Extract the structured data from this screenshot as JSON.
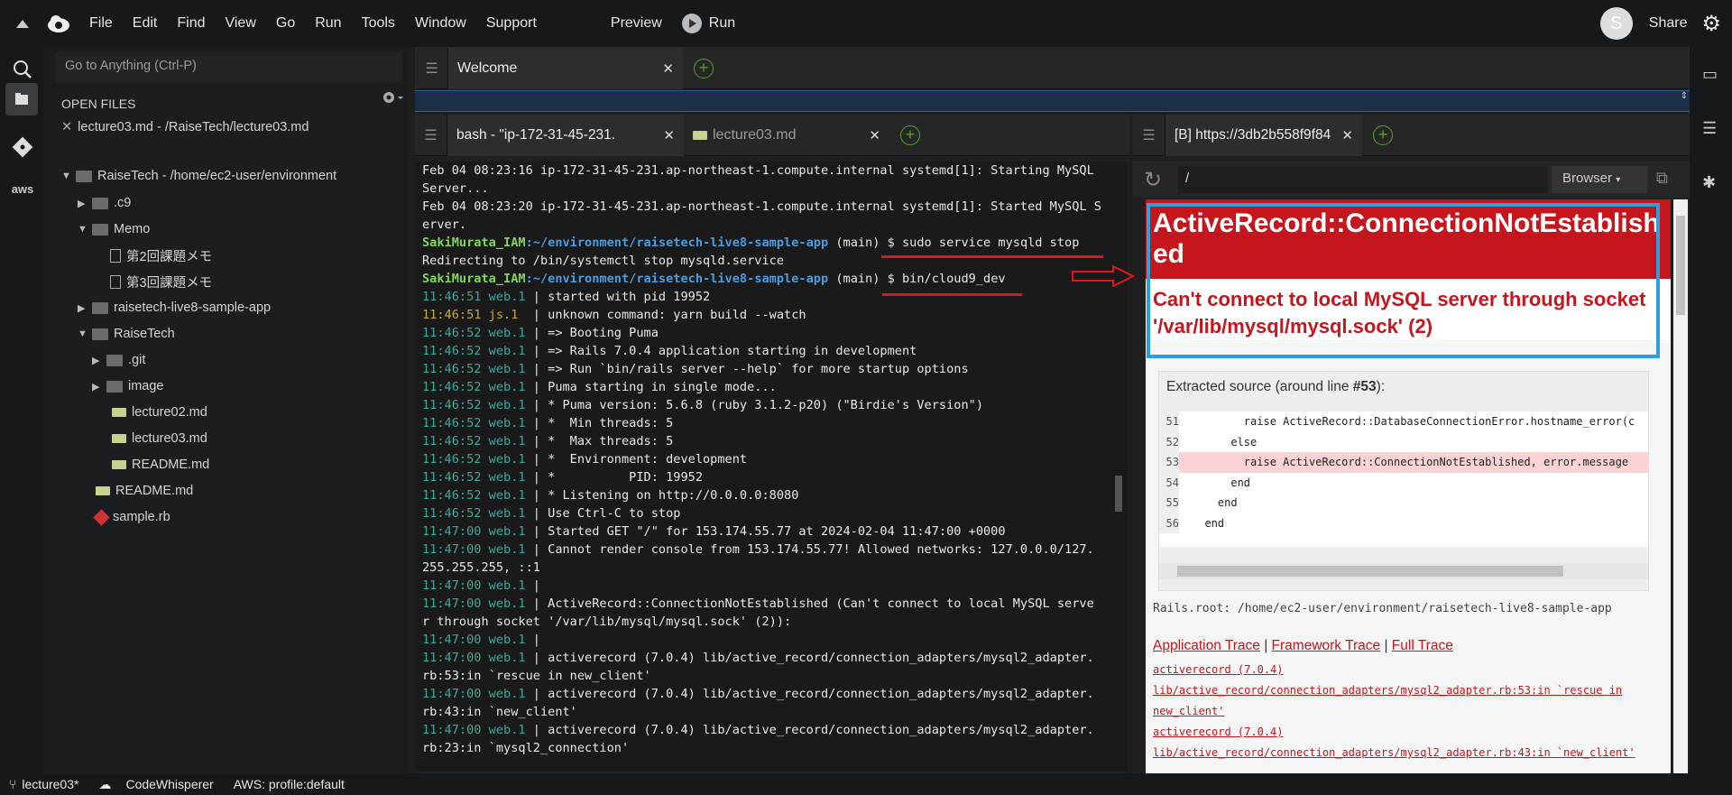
{
  "menubar": {
    "items": [
      "File",
      "Edit",
      "Find",
      "View",
      "Go",
      "Run",
      "Tools",
      "Window",
      "Support"
    ],
    "preview": "Preview",
    "run": "Run",
    "avatar_letter": "S",
    "share": "Share"
  },
  "sidebar": {
    "goto_placeholder": "Go to Anything (Ctrl-P)",
    "open_files_header": "OPEN FILES",
    "open_file": "lecture03.md - /RaiseTech/lecture03.md",
    "tree": [
      {
        "label": "RaiseTech - /home/ec2-user/environment",
        "kind": "folder",
        "open": true
      },
      {
        "label": ".c9",
        "kind": "folder",
        "open": false
      },
      {
        "label": "Memo",
        "kind": "folder",
        "open": true
      },
      {
        "label": "第2回課題メモ",
        "kind": "doc"
      },
      {
        "label": "第3回課題メモ",
        "kind": "doc"
      },
      {
        "label": "raisetech-live8-sample-app",
        "kind": "folder",
        "open": false
      },
      {
        "label": "RaiseTech",
        "kind": "folder",
        "open": true
      },
      {
        "label": ".git",
        "kind": "folder",
        "open": false
      },
      {
        "label": "image",
        "kind": "folder",
        "open": false
      },
      {
        "label": "lecture02.md",
        "kind": "md"
      },
      {
        "label": "lecture03.md",
        "kind": "md"
      },
      {
        "label": "README.md",
        "kind": "md"
      },
      {
        "label": "README.md",
        "kind": "md"
      },
      {
        "label": "sample.rb",
        "kind": "rb"
      }
    ]
  },
  "tabs": {
    "welcome": "Welcome",
    "bash": "bash - \"ip-172-31-45-231.",
    "lecture": "lecture03.md",
    "browser": "[B] https://3db2b558f9f84"
  },
  "terminal": {
    "lines": [
      [
        "",
        "Feb 04 08:23:16 ip-172-31-45-231.ap-northeast-1.compute.internal systemd[1]: Starting MySQL"
      ],
      [
        "",
        "Server..."
      ],
      [
        "",
        "Feb 04 08:23:20 ip-172-31-45-231.ap-northeast-1.compute.internal systemd[1]: Started MySQL S"
      ],
      [
        "",
        "erver."
      ],
      [
        "prompt",
        "$ sudo service mysqld stop"
      ],
      [
        "",
        "Redirecting to /bin/systemctl stop mysqld.service"
      ],
      [
        "prompt",
        "$ bin/cloud9_dev"
      ],
      [
        "11:46:51 web.1",
        "| started with pid 19952"
      ],
      [
        "11:46:51 js.1 ",
        "| unknown command: yarn build --watch"
      ],
      [
        "11:46:52 web.1",
        "| => Booting Puma"
      ],
      [
        "11:46:52 web.1",
        "| => Rails 7.0.4 application starting in development"
      ],
      [
        "11:46:52 web.1",
        "| => Run `bin/rails server --help` for more startup options"
      ],
      [
        "11:46:52 web.1",
        "| Puma starting in single mode..."
      ],
      [
        "11:46:52 web.1",
        "| * Puma version: 5.6.8 (ruby 3.1.2-p20) (\"Birdie's Version\")"
      ],
      [
        "11:46:52 web.1",
        "| *  Min threads: 5"
      ],
      [
        "11:46:52 web.1",
        "| *  Max threads: 5"
      ],
      [
        "11:46:52 web.1",
        "| *  Environment: development"
      ],
      [
        "11:46:52 web.1",
        "| *          PID: 19952"
      ],
      [
        "11:46:52 web.1",
        "| * Listening on http://0.0.0.0:8080"
      ],
      [
        "11:46:52 web.1",
        "| Use Ctrl-C to stop"
      ],
      [
        "11:47:00 web.1",
        "| Started GET \"/\" for 153.174.55.77 at 2024-02-04 11:47:00 +0000"
      ],
      [
        "11:47:00 web.1",
        "| Cannot render console from 153.174.55.77! Allowed networks: 127.0.0.0/127."
      ],
      [
        "",
        "255.255.255, ::1"
      ],
      [
        "11:47:00 web.1",
        "|"
      ],
      [
        "11:47:00 web.1",
        "| ActiveRecord::ConnectionNotEstablished (Can't connect to local MySQL serve"
      ],
      [
        "",
        "r through socket '/var/lib/mysql/mysql.sock' (2)):"
      ],
      [
        "11:47:00 web.1",
        "|"
      ],
      [
        "11:47:00 web.1",
        "| activerecord (7.0.4) lib/active_record/connection_adapters/mysql2_adapter."
      ],
      [
        "",
        "rb:53:in `rescue in new_client'"
      ],
      [
        "11:47:00 web.1",
        "| activerecord (7.0.4) lib/active_record/connection_adapters/mysql2_adapter."
      ],
      [
        "",
        "rb:43:in `new_client'"
      ],
      [
        "11:47:00 web.1",
        "| activerecord (7.0.4) lib/active_record/connection_adapters/mysql2_adapter."
      ],
      [
        "",
        "rb:23:in `mysql2_connection'"
      ]
    ],
    "prompt_user": "SakiMurata_IAM",
    "prompt_path": ":~/environment/raisetech-live8-sample-app",
    "prompt_branch": " (main) "
  },
  "browser": {
    "url": "/",
    "browser_btn": "Browser",
    "error_title": "ActiveRecord::ConnectionNotEstablished",
    "error_message": "Can't connect to local MySQL server through socket '/var/lib/mysql/mysql.sock' (2)",
    "extracted_prefix": "Extracted source (around line ",
    "extracted_line": "#53",
    "extracted_suffix": "):",
    "code": [
      [
        "51",
        "        raise ActiveRecord::DatabaseConnectionError.hostname_error(c"
      ],
      [
        "52",
        "      else"
      ],
      [
        "53",
        "        raise ActiveRecord::ConnectionNotEstablished, error.message"
      ],
      [
        "54",
        "      end"
      ],
      [
        "55",
        "    end"
      ],
      [
        "56",
        "  end"
      ]
    ],
    "rails_root": "Rails.root: /home/ec2-user/environment/raisetech-live8-sample-app",
    "app_trace": "Application Trace",
    "framework_trace": "Framework Trace",
    "full_trace": "Full Trace",
    "sep": " | ",
    "trace_lines": [
      "activerecord (7.0.4)",
      "lib/active_record/connection_adapters/mysql2_adapter.rb:53:in `rescue in",
      "new_client'",
      "activerecord (7.0.4)",
      "lib/active_record/connection_adapters/mysql2_adapter.rb:43:in `new_client'"
    ]
  },
  "statusbar": {
    "branch": "lecture03*",
    "codewhisperer": "CodeWhisperer",
    "aws": "AWS: profile:default"
  }
}
